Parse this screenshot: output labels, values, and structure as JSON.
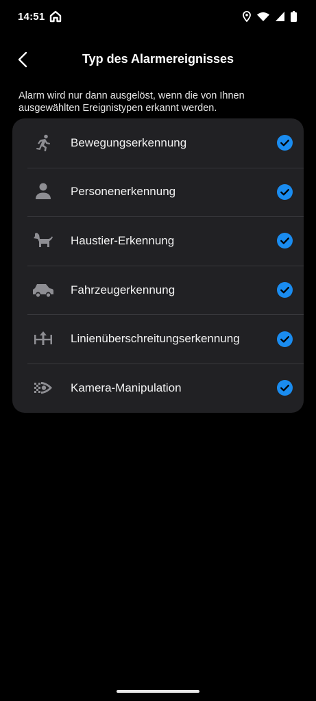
{
  "status_bar": {
    "time": "14:51"
  },
  "header": {
    "title": "Typ des Alarmereignisses"
  },
  "description": "Alarm wird nur dann ausgelöst, wenn die von Ihnen ausgewählten Ereignistypen erkannt werden.",
  "events": [
    {
      "label": "Bewegungserkennung",
      "icon": "running-person-icon",
      "checked": true
    },
    {
      "label": "Personenerkennung",
      "icon": "person-icon",
      "checked": true
    },
    {
      "label": "Haustier-Erkennung",
      "icon": "dog-icon",
      "checked": true
    },
    {
      "label": "Fahrzeugerkennung",
      "icon": "car-icon",
      "checked": true
    },
    {
      "label": "Linienüberschreitungserkennung",
      "icon": "line-crossing-icon",
      "checked": true
    },
    {
      "label": "Kamera-Manipulation",
      "icon": "camera-tamper-icon",
      "checked": true
    }
  ],
  "colors": {
    "accent": "#1a8cf0",
    "card": "#212124",
    "icon": "#8e8e93"
  }
}
